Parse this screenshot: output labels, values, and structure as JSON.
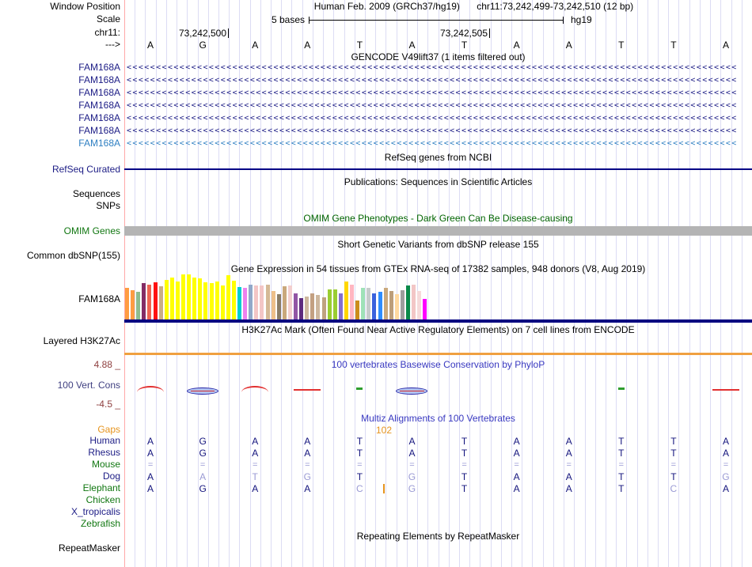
{
  "colors": {
    "gene_navy": "#1c1c85",
    "gene_light_blue": "#2e7fc2",
    "label_green": "#117711",
    "omim_green": "#006400",
    "gaps_orange": "#e6941e",
    "cons_tick_maroon": "#8e3f3f",
    "title_blue": "#3838c0",
    "grid_line": "#dcdcf4",
    "grid_first_line": "#ffa8a8",
    "omim_gray_bar": "#b4b4b4",
    "refseq_line_navy": "#000085",
    "gtex_baseline_navy": "#000080",
    "h3k27ac_orange_line": "#f0a040",
    "multiz_dark_letter": "#14147e",
    "multiz_light_letter": "#9a9ad4"
  },
  "header": {
    "window_position_label": "Window Position",
    "assembly_line": "Human Feb. 2009 (GRCh37/hg19)",
    "position_line": "chr11:73,242,499-73,242,510 (12 bp)",
    "scale_label": "Scale",
    "scale_value": "5 bases",
    "assembly_short": "hg19",
    "chrom_label": "chr11:",
    "coord_ticks": [
      "73,242,500",
      "73,242,505"
    ],
    "strand_arrow": "--->",
    "bases": [
      "A",
      "G",
      "A",
      "A",
      "T",
      "A",
      "T",
      "A",
      "A",
      "T",
      "T",
      "A"
    ]
  },
  "tracks": {
    "gencode": {
      "title": "GENCODE V49lift37 (1 items filtered out)",
      "arrow_char": "<",
      "items": [
        {
          "label": "FAM168A",
          "color": "#1c1c85"
        },
        {
          "label": "FAM168A",
          "color": "#1c1c85"
        },
        {
          "label": "FAM168A",
          "color": "#1c1c85"
        },
        {
          "label": "FAM168A",
          "color": "#1c1c85"
        },
        {
          "label": "FAM168A",
          "color": "#1c1c85"
        },
        {
          "label": "FAM168A",
          "color": "#1c1c85"
        },
        {
          "label": "FAM168A",
          "color": "#2e7fc2"
        }
      ]
    },
    "refseq": {
      "title": "RefSeq genes from NCBI",
      "label": "RefSeq Curated"
    },
    "publications": {
      "title": "Publications: Sequences in Scientific Articles",
      "label_sequences": "Sequences",
      "label_snps": "SNPs"
    },
    "omim": {
      "title": "OMIM Gene Phenotypes - Dark Green Can Be Disease-causing",
      "label": "OMIM Genes"
    },
    "dbsnp": {
      "title": "Short Genetic Variants from dbSNP release 155",
      "label": "Common dbSNP(155)"
    },
    "gtex": {
      "title": "Gene Expression in 54 tissues from GTEx RNA-seq of 17382 samples, 948 donors (V8, Aug 2019)",
      "label": "FAM168A"
    },
    "h3k27ac": {
      "title": "H3K27Ac Mark (Often Found Near Active Regulatory Elements) on 7 cell lines from ENCODE",
      "label": "Layered H3K27Ac"
    },
    "conservation": {
      "title": "100 vertebrates Basewise Conservation by PhyloP",
      "label": "100 Vert. Cons",
      "max_tick": "4.88 _",
      "min_tick": "-4.5 _",
      "marks": [
        {
          "col": 1,
          "type": "red-bump"
        },
        {
          "col": 2,
          "type": "blue-oval"
        },
        {
          "col": 3,
          "type": "red-bump"
        },
        {
          "col": 4,
          "type": "red-line"
        },
        {
          "col": 5,
          "type": "green-tick"
        },
        {
          "col": 6,
          "type": "blue-oval"
        },
        {
          "col": 10,
          "type": "green-tick"
        },
        {
          "col": 12,
          "type": "red-line"
        }
      ]
    },
    "multiz": {
      "title": "Multiz Alignments of 100 Vertebrates",
      "gaps_label": "Gaps",
      "gap_value": "102",
      "species": [
        {
          "name": "Human",
          "label_color": "#1c1c85",
          "letters": [
            "A",
            "G",
            "A",
            "A",
            "T",
            "A",
            "T",
            "A",
            "A",
            "T",
            "T",
            "A"
          ],
          "shades": [
            "d",
            "d",
            "d",
            "d",
            "d",
            "d",
            "d",
            "d",
            "d",
            "d",
            "d",
            "d"
          ],
          "eq_row": false,
          "has_gap_bar": false
        },
        {
          "name": "Rhesus",
          "label_color": "#1c1c85",
          "letters": [
            "A",
            "G",
            "A",
            "A",
            "T",
            "A",
            "T",
            "A",
            "A",
            "T",
            "T",
            "A"
          ],
          "shades": [
            "d",
            "d",
            "d",
            "d",
            "d",
            "d",
            "d",
            "d",
            "d",
            "d",
            "d",
            "d"
          ],
          "eq_row": false,
          "has_gap_bar": false
        },
        {
          "name": "Mouse",
          "label_color": "#117711",
          "letters": [
            "=",
            "=",
            "=",
            "=",
            "=",
            "=",
            "=",
            "=",
            "=",
            "=",
            "=",
            "="
          ],
          "shades": [
            "l",
            "l",
            "l",
            "l",
            "l",
            "l",
            "l",
            "l",
            "l",
            "l",
            "l",
            "l"
          ],
          "eq_row": true,
          "has_gap_bar": false
        },
        {
          "name": "Dog",
          "label_color": "#1c1c85",
          "letters": [
            "A",
            "A",
            "T",
            "G",
            "T",
            "G",
            "T",
            "A",
            "A",
            "T",
            "T",
            "G"
          ],
          "shades": [
            "d",
            "l",
            "l",
            "l",
            "d",
            "l",
            "d",
            "d",
            "d",
            "d",
            "d",
            "l"
          ],
          "eq_row": false,
          "has_gap_bar": false
        },
        {
          "name": "Elephant",
          "label_color": "#117711",
          "letters": [
            "A",
            "G",
            "A",
            "A",
            "C",
            "G",
            "T",
            "A",
            "A",
            "T",
            "C",
            "A"
          ],
          "shades": [
            "d",
            "d",
            "d",
            "d",
            "l",
            "l",
            "d",
            "d",
            "d",
            "d",
            "l",
            "d"
          ],
          "eq_row": false,
          "has_gap_bar": true
        },
        {
          "name": "Chicken",
          "label_color": "#117711",
          "letters": [],
          "shades": [],
          "eq_row": false,
          "has_gap_bar": false
        },
        {
          "name": "X_tropicalis",
          "label_color": "#1c1c85",
          "letters": [],
          "shades": [],
          "eq_row": false,
          "has_gap_bar": false
        },
        {
          "name": "Zebrafish",
          "label_color": "#117711",
          "letters": [],
          "shades": [],
          "eq_row": false,
          "has_gap_bar": false
        }
      ]
    },
    "repeatmasker": {
      "title": "Repeating Elements by RepeatMasker",
      "label": "RepeatMasker"
    }
  },
  "chart_data": {
    "type": "bar",
    "title": "Gene Expression in 54 tissues from GTEx RNA-seq of 17382 samples, 948 donors (V8, Aug 2019)",
    "gene": "FAM168A",
    "note": "no numeric y-axis shown; values are bar heights in screen pixels, colors are GTEx tissue colors",
    "bars": [
      {
        "color": "#ff9c42",
        "h": 40
      },
      {
        "color": "#ff9c42",
        "h": 37
      },
      {
        "color": "#8fbc8f",
        "h": 35
      },
      {
        "color": "#842c66",
        "h": 46
      },
      {
        "color": "#ee6352",
        "h": 44
      },
      {
        "color": "#ff1111",
        "h": 47
      },
      {
        "color": "#c9ad85",
        "h": 42
      },
      {
        "color": "#ffff00",
        "h": 50
      },
      {
        "color": "#ffff00",
        "h": 53
      },
      {
        "color": "#ffff00",
        "h": 48
      },
      {
        "color": "#ffff00",
        "h": 57
      },
      {
        "color": "#ffff00",
        "h": 57
      },
      {
        "color": "#ffff00",
        "h": 53
      },
      {
        "color": "#ffff00",
        "h": 52
      },
      {
        "color": "#ffff00",
        "h": 47
      },
      {
        "color": "#ffff00",
        "h": 46
      },
      {
        "color": "#ffff00",
        "h": 48
      },
      {
        "color": "#ffff00",
        "h": 43
      },
      {
        "color": "#ffff00",
        "h": 56
      },
      {
        "color": "#ffff00",
        "h": 49
      },
      {
        "color": "#00ced1",
        "h": 41
      },
      {
        "color": "#ee82ee",
        "h": 40
      },
      {
        "color": "#91a8c9",
        "h": 44
      },
      {
        "color": "#f3c6c6",
        "h": 43
      },
      {
        "color": "#f3c6c6",
        "h": 43
      },
      {
        "color": "#d4b996",
        "h": 44
      },
      {
        "color": "#eec08a",
        "h": 36
      },
      {
        "color": "#8b7d66",
        "h": 32
      },
      {
        "color": "#c9a87c",
        "h": 42
      },
      {
        "color": "#f3cfcf",
        "h": 43
      },
      {
        "color": "#9256a5",
        "h": 33
      },
      {
        "color": "#5e2b7e",
        "h": 27
      },
      {
        "color": "#cdb79e",
        "h": 29
      },
      {
        "color": "#c3a082",
        "h": 33
      },
      {
        "color": "#cdb79e",
        "h": 31
      },
      {
        "color": "#bfa380",
        "h": 28
      },
      {
        "color": "#9acd32",
        "h": 38
      },
      {
        "color": "#9acd32",
        "h": 38
      },
      {
        "color": "#8470ce",
        "h": 33
      },
      {
        "color": "#ffd700",
        "h": 48
      },
      {
        "color": "#ffb6c1",
        "h": 44
      },
      {
        "color": "#cc8d1a",
        "h": 24
      },
      {
        "color": "#9fe2b8",
        "h": 40
      },
      {
        "color": "#c6cccc",
        "h": 40
      },
      {
        "color": "#3a62dd",
        "h": 33
      },
      {
        "color": "#2d8cff",
        "h": 35
      },
      {
        "color": "#c9a87c",
        "h": 40
      },
      {
        "color": "#bd9e7a",
        "h": 36
      },
      {
        "color": "#ffd9a0",
        "h": 32
      },
      {
        "color": "#9e9e9e",
        "h": 37
      },
      {
        "color": "#0a8a4a",
        "h": 43
      },
      {
        "color": "#f3c6c6",
        "h": 44
      },
      {
        "color": "#f6dada",
        "h": 36
      },
      {
        "color": "#ff00ff",
        "h": 26
      }
    ]
  }
}
